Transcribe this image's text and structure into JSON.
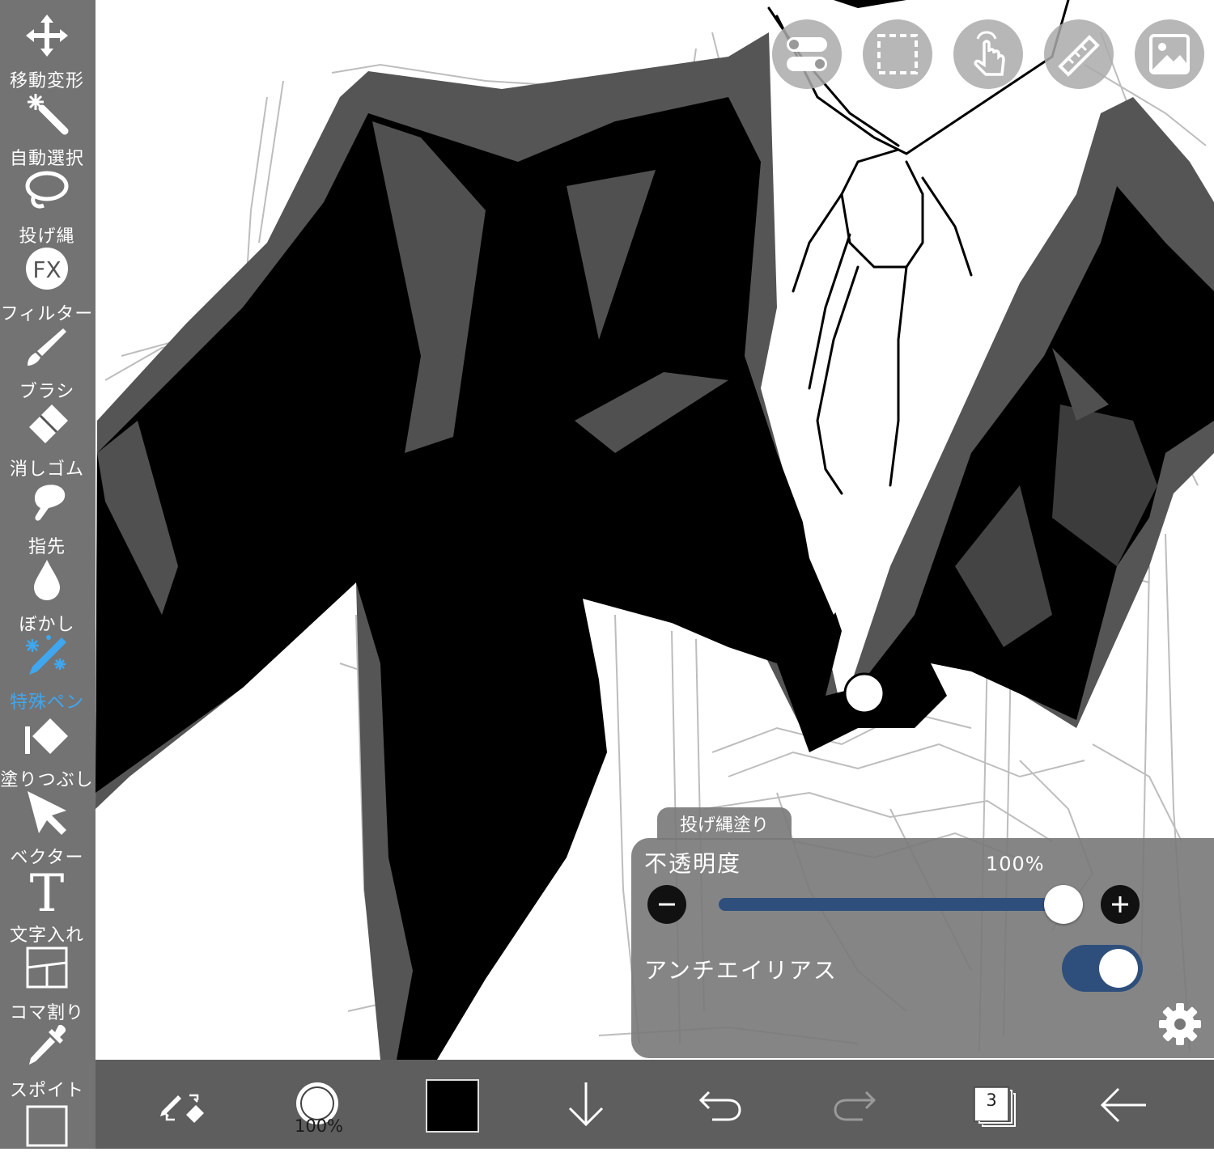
{
  "toolbar": {
    "items": [
      {
        "label": "移動変形",
        "icon": "move-icon",
        "active": false
      },
      {
        "label": "自動選択",
        "icon": "magic-wand-icon",
        "active": false
      },
      {
        "label": "投げ縄",
        "icon": "lasso-icon",
        "active": false
      },
      {
        "label": "フィルター",
        "icon": "fx-filter-icon",
        "active": false
      },
      {
        "label": "ブラシ",
        "icon": "brush-icon",
        "active": false
      },
      {
        "label": "消しゴム",
        "icon": "eraser-icon",
        "active": false
      },
      {
        "label": "指先",
        "icon": "finger-smudge-icon",
        "active": false
      },
      {
        "label": "ぼかし",
        "icon": "blur-drop-icon",
        "active": false
      },
      {
        "label": "特殊ペン",
        "icon": "special-pen-icon",
        "active": true
      },
      {
        "label": "塗りつぶし",
        "icon": "fill-bucket-icon",
        "active": false
      },
      {
        "label": "ベクター",
        "icon": "vector-arrow-icon",
        "active": false
      },
      {
        "label": "文字入れ",
        "icon": "text-icon",
        "active": false
      },
      {
        "label": "コマ割り",
        "icon": "frame-divider-icon",
        "active": false
      },
      {
        "label": "スポイト",
        "icon": "eyedropper-icon",
        "active": false
      }
    ],
    "active_color": "#3ea7f0"
  },
  "top_buttons": [
    "toggle-settings-icon",
    "selection-icon",
    "touch-gesture-icon",
    "ruler-icon",
    "gallery-image-icon"
  ],
  "bottom_bar": {
    "brush_size": "100%",
    "layer_count": "3",
    "current_color": "#000000",
    "icons": [
      "swap-pen-eraser-icon",
      "brush-size-icon",
      "color-swatch",
      "download-arrow-icon",
      "undo-icon",
      "redo-icon",
      "layers-icon",
      "back-arrow-icon"
    ]
  },
  "panel": {
    "tab_label": "投げ縄塗り",
    "opacity_label": "不透明度",
    "opacity_value": "100%",
    "opacity": 1.0,
    "antialias_label": "アンチエイリアス",
    "antialias_on": true,
    "accent": "#2e4f7c"
  }
}
